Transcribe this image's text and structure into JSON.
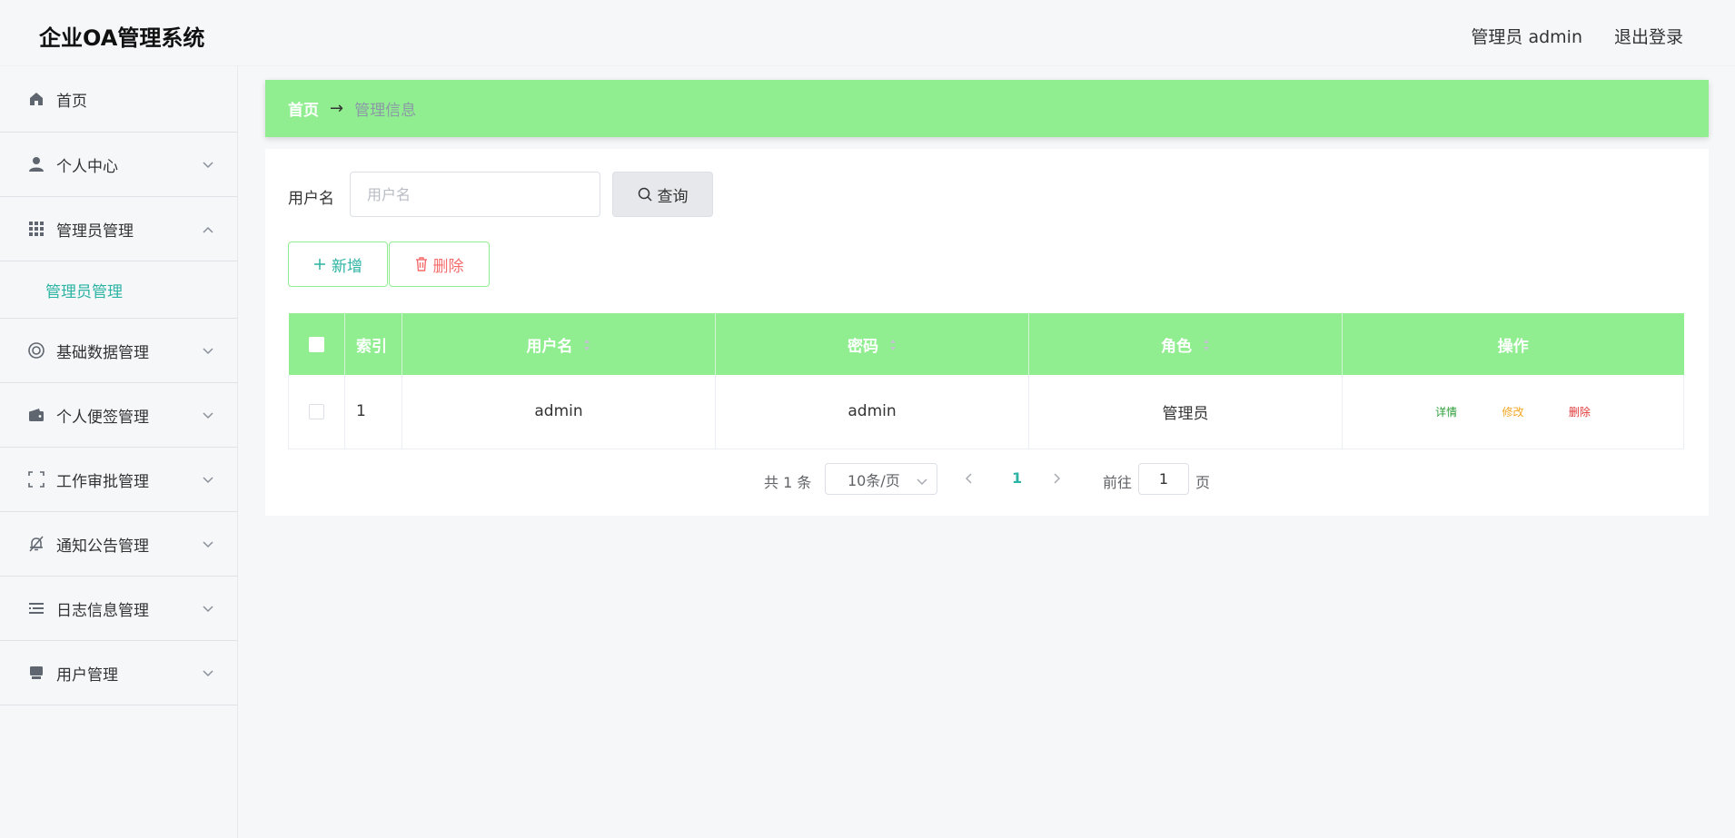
{
  "app": {
    "title": "企业OA管理系统"
  },
  "header": {
    "user_label": "管理员 admin",
    "logout_label": "退出登录"
  },
  "sidebar": {
    "items": [
      {
        "label": "首页",
        "icon": "home-icon"
      },
      {
        "label": "个人中心",
        "icon": "user-icon",
        "chevron": "down"
      },
      {
        "label": "管理员管理",
        "icon": "grid-icon",
        "chevron": "up",
        "expanded": true,
        "children": [
          {
            "label": "管理员管理",
            "active": true
          }
        ]
      },
      {
        "label": "基础数据管理",
        "icon": "lifebuoy-icon",
        "chevron": "down"
      },
      {
        "label": "个人便签管理",
        "icon": "wallet-icon",
        "chevron": "down"
      },
      {
        "label": "工作审批管理",
        "icon": "frame-icon",
        "chevron": "down"
      },
      {
        "label": "通知公告管理",
        "icon": "bell-off-icon",
        "chevron": "down"
      },
      {
        "label": "日志信息管理",
        "icon": "list-icon",
        "chevron": "down"
      },
      {
        "label": "用户管理",
        "icon": "inbox-icon",
        "chevron": "down"
      }
    ]
  },
  "breadcrumb": {
    "home": "首页",
    "separator": "→",
    "current": "管理信息"
  },
  "search": {
    "label": "用户名",
    "placeholder": "用户名",
    "button_label": "查询"
  },
  "actions": {
    "add_label": "新增",
    "delete_label": "删除"
  },
  "table": {
    "headers": {
      "index": "索引",
      "username": "用户名",
      "password": "密码",
      "role": "角色",
      "operation": "操作"
    },
    "rows": [
      {
        "index": "1",
        "username": "admin",
        "password": "admin",
        "role": "管理员"
      }
    ],
    "row_actions": {
      "detail": "详情",
      "edit": "修改",
      "delete": "删除"
    }
  },
  "pagination": {
    "total_text": "共 1 条",
    "page_size": "10条/页",
    "current_page": "1",
    "goto_label": "前往",
    "goto_value": "1",
    "page_unit": "页"
  },
  "colors": {
    "accent_green": "#90ee90",
    "teal": "#2bb3a3",
    "danger": "#f56c6c",
    "warning": "#f5a623"
  }
}
